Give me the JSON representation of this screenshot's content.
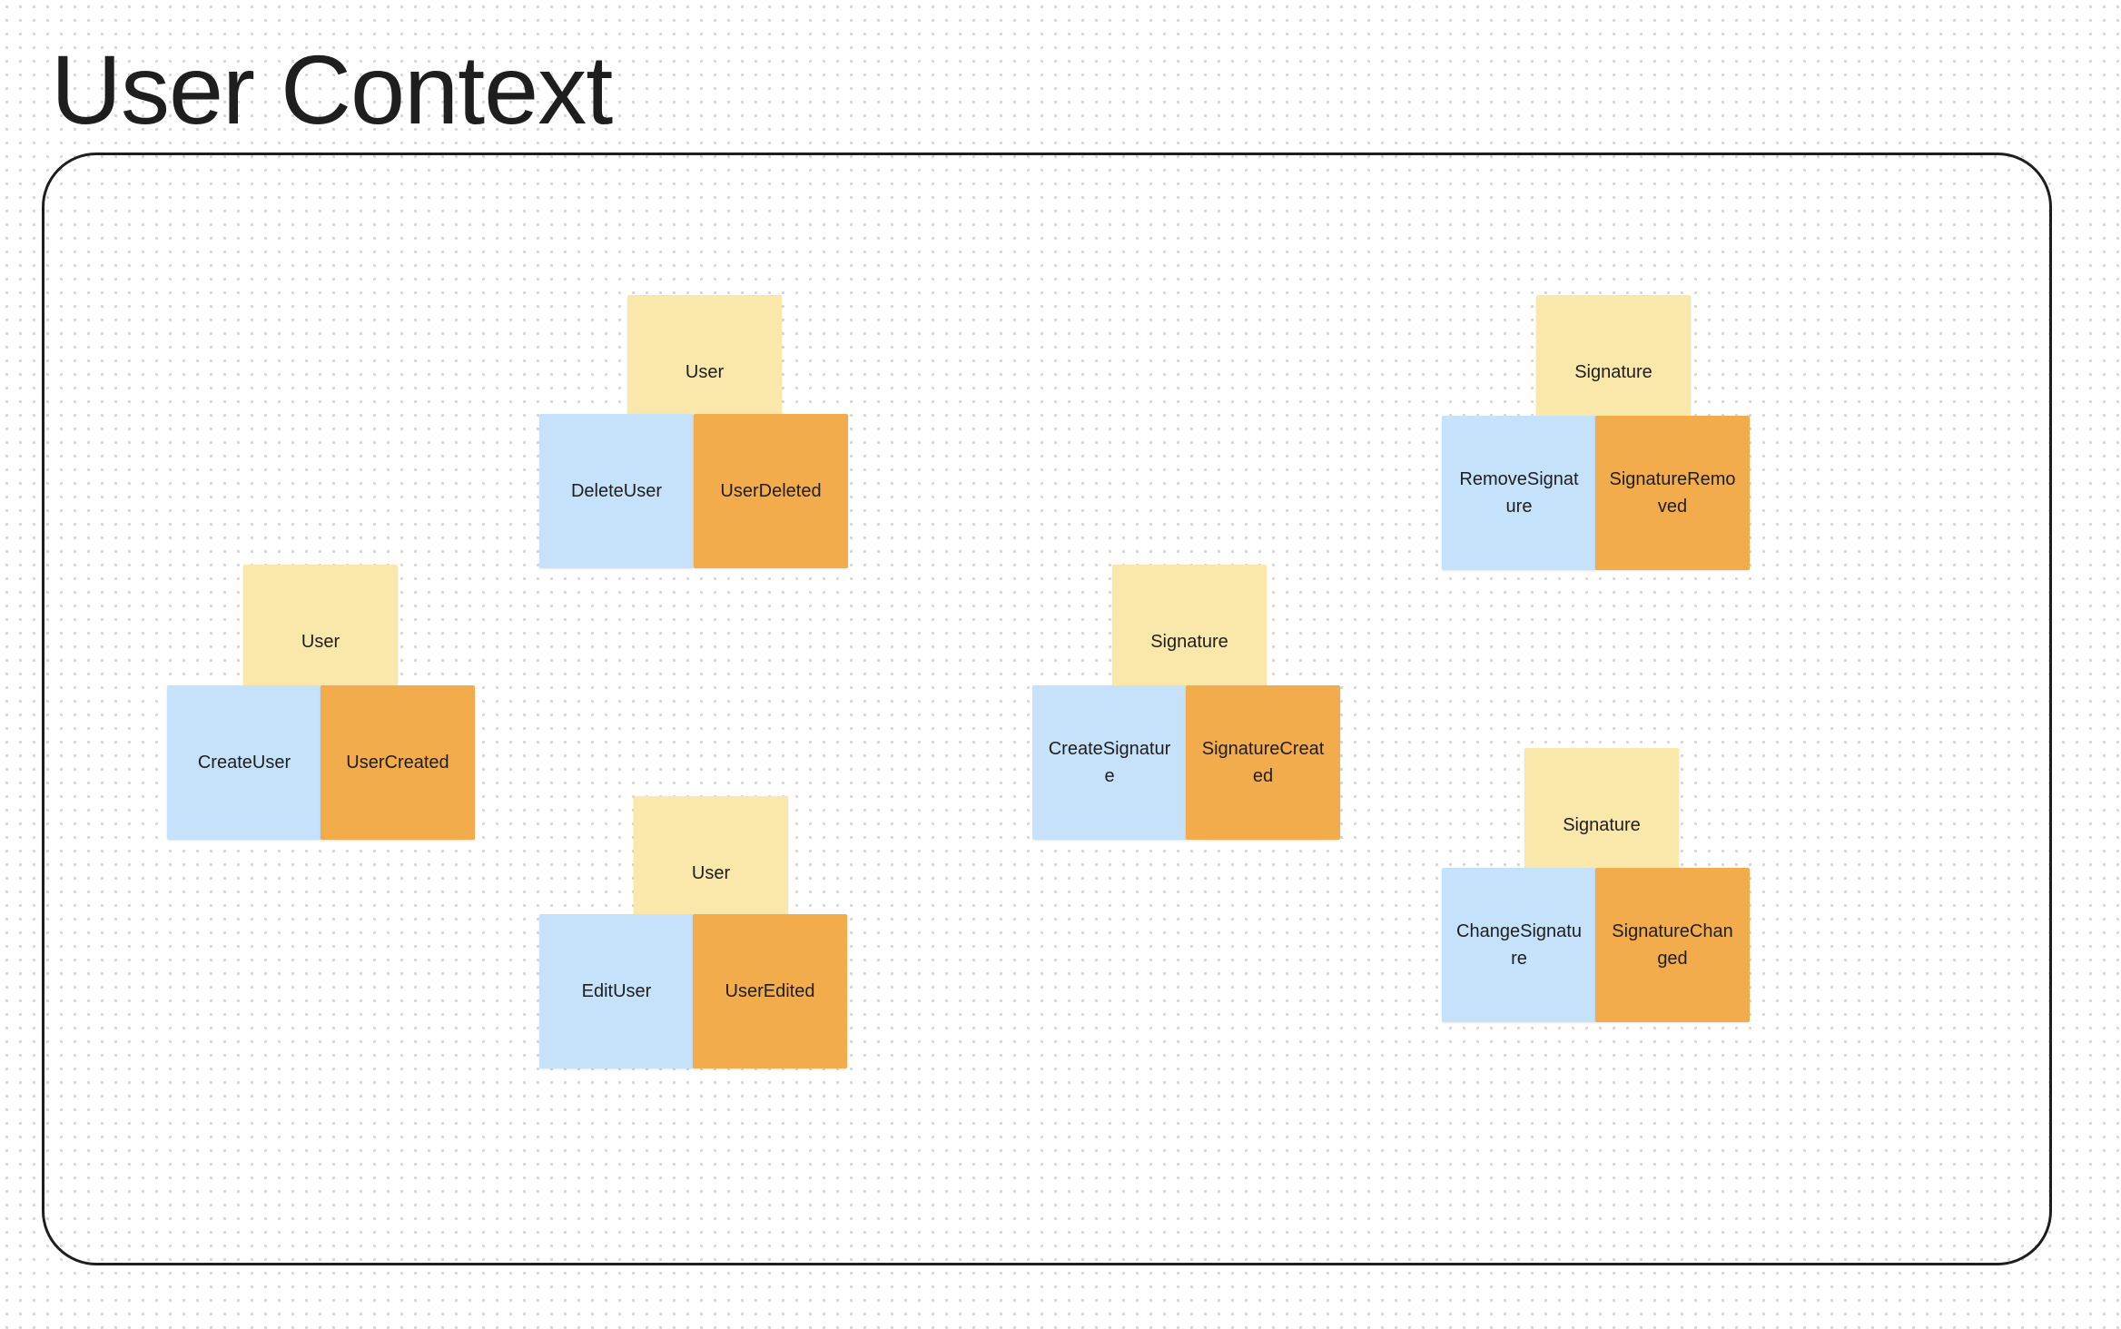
{
  "board": {
    "title": "User Context"
  },
  "colors": {
    "aggregate": "#fae8aa",
    "command": "#c5e2fa",
    "event": "#f2ac4b",
    "frame_border": "#1e1e1e"
  },
  "groups": [
    {
      "aggregate": "User",
      "command": "CreateUser",
      "event": "UserCreated"
    },
    {
      "aggregate": "User",
      "command": "DeleteUser",
      "event": "UserDeleted"
    },
    {
      "aggregate": "User",
      "command": "EditUser",
      "event": "UserEdited"
    },
    {
      "aggregate": "Signature",
      "command": "CreateSignature",
      "event": "SignatureCreated"
    },
    {
      "aggregate": "Signature",
      "command": "RemoveSignature",
      "event": "SignatureRemoved"
    },
    {
      "aggregate": "Signature",
      "command": "ChangeSignature",
      "event": "SignatureChanged"
    }
  ]
}
